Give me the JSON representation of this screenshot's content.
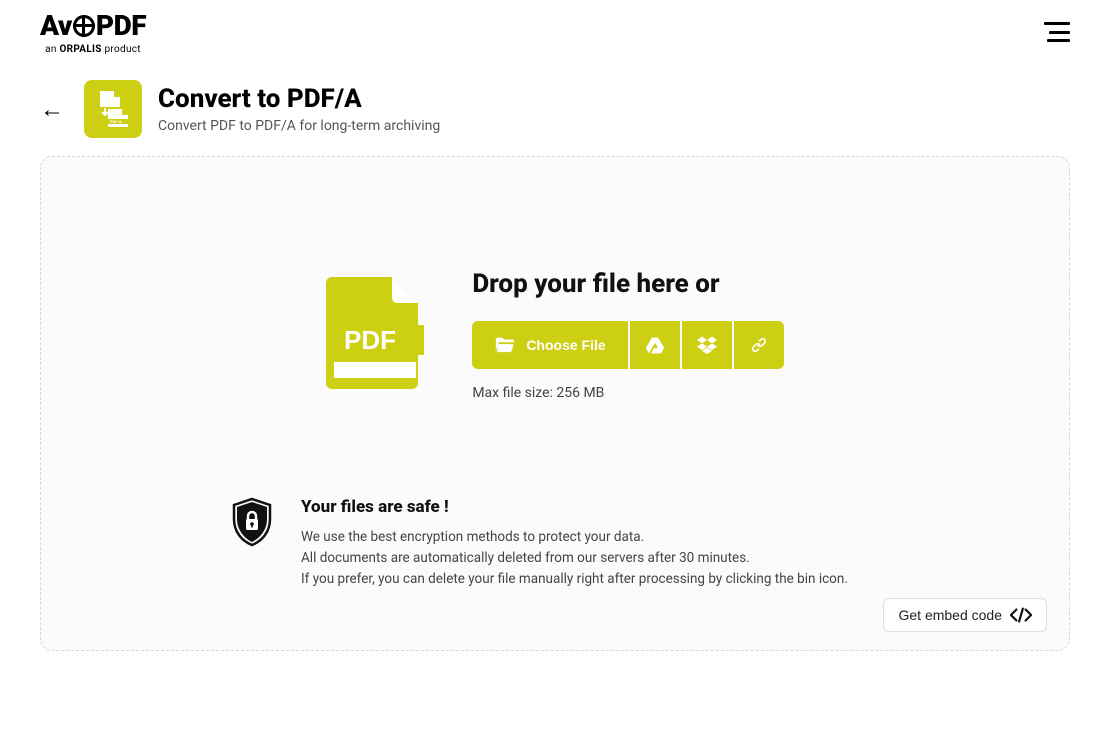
{
  "brand": {
    "name_prefix": "Av",
    "name_suffix": "PDF",
    "subline_prefix": "an ",
    "subline_brand": "ORPALIS",
    "subline_suffix": " product"
  },
  "tool": {
    "title": "Convert to PDF/A",
    "subtitle": "Convert PDF to PDF/A for long-term archiving"
  },
  "dropzone": {
    "heading": "Drop your file here or",
    "choose_label": "Choose File",
    "max_size": "Max file size: 256 MB"
  },
  "safety": {
    "title": "Your files are safe !",
    "line1": "We use the best encryption methods to protect your data.",
    "line2": "All documents are automatically deleted from our servers after 30 minutes.",
    "line3": "If you prefer, you can delete your file manually right after processing by clicking the bin icon."
  },
  "footer": {
    "embed_label": "Get embed code"
  },
  "colors": {
    "accent": "#cdcf12"
  }
}
